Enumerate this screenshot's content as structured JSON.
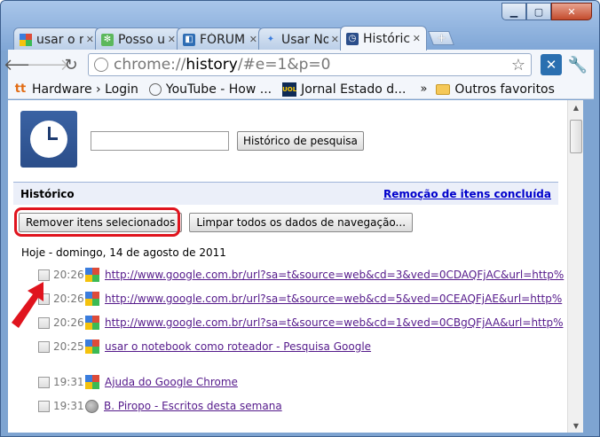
{
  "tabs": [
    {
      "title": "usar o notebook",
      "icon": "google-icon",
      "active": false
    },
    {
      "title": "Posso usar",
      "icon": "puzzle-icon",
      "active": false
    },
    {
      "title": "FÓRUM",
      "icon": "forum-icon",
      "active": false
    },
    {
      "title": "Usar Notebook",
      "icon": "puzzle-icon",
      "active": false
    },
    {
      "title": "Históric",
      "icon": "history-clock-icon",
      "active": true
    }
  ],
  "toolbar": {
    "url_prefix": "chrome://",
    "url_host": "history",
    "url_suffix": "/#e=1&p=0"
  },
  "bookmarks": [
    {
      "label": "Hardware › Login",
      "icon": "tt-icon"
    },
    {
      "label": "YouTube - How ...",
      "icon": "globe-icon"
    },
    {
      "label": "Jornal Estado d...",
      "icon": "uol-icon"
    }
  ],
  "bookmarks_other": "Outros favoritos",
  "search": {
    "value": "",
    "button_label": "Histórico de pesquisa"
  },
  "history": {
    "title": "Histórico",
    "status_link": "Remoção de itens concluída",
    "remove_button": "Remover itens selecionados",
    "clear_button": "Limpar todos os dados de navegação...",
    "day_label": "Hoje - domingo, 14 de agosto de 2011",
    "entries": [
      {
        "time": "20:26",
        "icon": "google-icon",
        "text": "http://www.google.com.br/url?sa=t&source=web&cd=3&ved=0CDAQFjAC&url=http%"
      },
      {
        "time": "20:26",
        "icon": "google-icon",
        "text": "http://www.google.com.br/url?sa=t&source=web&cd=5&ved=0CEAQFjAE&url=http%"
      },
      {
        "time": "20:26",
        "icon": "google-icon",
        "text": "http://www.google.com.br/url?sa=t&source=web&cd=1&ved=0CBgQFjAA&url=http%"
      },
      {
        "time": "20:25",
        "icon": "google-icon",
        "text": "usar o notebook como roteador - Pesquisa Google"
      },
      {
        "time": "19:31",
        "icon": "google-icon",
        "text": "Ajuda do Google Chrome"
      },
      {
        "time": "19:31",
        "icon": "globe-icon",
        "text": "B. Piropo - Escritos desta semana"
      }
    ]
  },
  "colors": {
    "frame": "#7ea4d1",
    "highlight_box": "#e0141e",
    "link": "#551a8b",
    "status_link": "#0000cc"
  }
}
